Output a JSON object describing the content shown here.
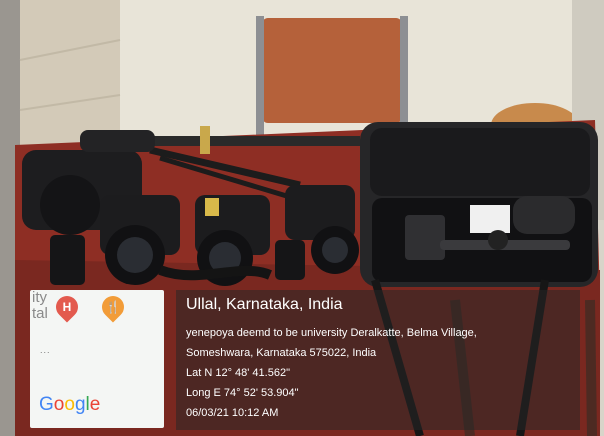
{
  "overlay": {
    "title": "Ullal, Karnataka, India",
    "address_line1": "yenepoya deemd to be university Deralkatte, Belma Village,",
    "address_line2": "Someshwara, Karnataka 575022, India",
    "latitude": "Lat N 12° 48' 41.562\"",
    "longitude": "Long E 74° 52' 53.904\"",
    "datetime": "06/03/21 10:12 AM"
  },
  "map": {
    "fragment_1": "ity",
    "fragment_2": "tal",
    "hospital_pin": "H",
    "restaurant_pin": "🍴",
    "dots": "...",
    "logo": "Google",
    "hospital_pin_color": "#e35a4e",
    "restaurant_pin_color": "#f29c38"
  }
}
